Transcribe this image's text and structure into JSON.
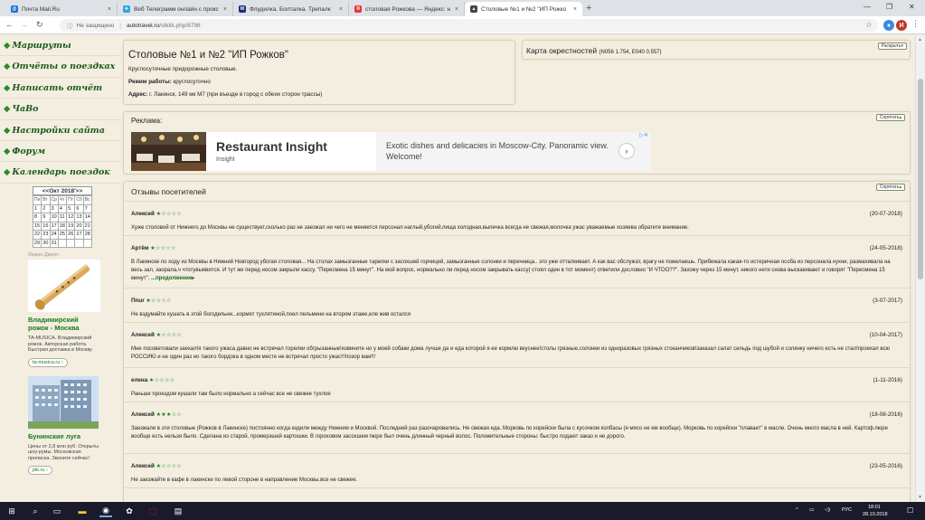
{
  "browser": {
    "tabs": [
      {
        "title": "Почта Mail.Ru",
        "color": "#1e6fd9",
        "glyph": "@"
      },
      {
        "title": "Веб Телеграмм онлайн с прокс",
        "color": "#2ca5e0",
        "glyph": "✈"
      },
      {
        "title": "Флудилка. Болталка. Трепалк",
        "color": "#1c2f7a",
        "glyph": "M"
      },
      {
        "title": "столовая Рожкова — Яндекс: н",
        "color": "#e33",
        "glyph": "Я"
      },
      {
        "title": "Столовые №1 и №2 \"ИП Рожко",
        "color": "#444",
        "glyph": "▲"
      }
    ],
    "new_tab": "+",
    "insecure_label": "Не защищено",
    "url_domain": "autotravel.ru",
    "url_path": "/otklik.php/8798",
    "profile_letter": "И"
  },
  "menu": [
    "Маршруты",
    "Отчёты о поездках",
    "Написать отчёт",
    "ЧаВо",
    "Настройки сайта",
    "Форум",
    "Календарь поездок"
  ],
  "calendar": {
    "header": "<<Окт 2018'>>",
    "days": [
      "Пн",
      "Вт",
      "Ср",
      "Чт",
      "Пт",
      "Сб",
      "Вс"
    ],
    "cells": [
      "1",
      "2",
      "3",
      "4",
      "5",
      "6",
      "7",
      "8",
      "9",
      "10",
      "11",
      "12",
      "13",
      "14",
      "15",
      "16",
      "17",
      "18",
      "19",
      "20",
      "21",
      "22",
      "23",
      "24",
      "25",
      "26",
      "27",
      "28",
      "29",
      "30",
      "31"
    ]
  },
  "side_ads": [
    {
      "label": "Яндекс.Директ",
      "title": "Владимирский рожок - Москва",
      "text": "TA-MUSICA. Владимирский рожок. Авторская работа. Быстрая доставка в Москву",
      "link": "ta-musica.ru ›"
    },
    {
      "title": "Бунинские луга",
      "text": "Цены от 2,8 млн руб. Открыты шоу-румы. Московская прописка. Звоните сейчас!",
      "link": "pik.ru ›"
    }
  ],
  "place": {
    "title": "Столовые №1 и №2 \"ИП Рожков\"",
    "desc": "Круглосуточные придорожные столовые.",
    "hours_label": "Режим работы:",
    "hours_value": "круглосуточно",
    "address_label": "Адрес:",
    "address_value": "г. Лакинск, 149 км М7 (при въезде в город с обеих сторон трассы)"
  },
  "map_box": {
    "title": "Карта окрестностей",
    "coords": "(N056 1.754, E040 0.557)",
    "expand_label": "Раскрыть"
  },
  "ads_box": {
    "title": "Реклама:",
    "hide_label": "Спрятать",
    "banner_title": "Restaurant Insight",
    "banner_sub": "Insight",
    "banner_desc": "Exotic dishes and delicacies in Moscow-City. Panoramic view. Welcome!"
  },
  "reviews_box": {
    "title": "Отзывы посетителей",
    "hide_label": "Спрятать",
    "more_label": "...продолжение▸",
    "items": [
      {
        "name": "Алексей",
        "stars": "★☆☆☆☆",
        "date": "(20-07-2018)",
        "text": "Хуже столовой от Нижнего до Москвы не существует,сколько раз не заезжал ни чего не меняется персонал наглый,убогий,пища холодная,выпечка всегда не свежая,молочка ужас уважаемые хозяева обратите внимание."
      },
      {
        "name": "Артём",
        "stars": "★☆☆☆☆",
        "date": "(24-05-2018)",
        "text": "В Лакинске по ходу из Москвы в Нижний Новгород убогая столовая... На столах замызганные тарелки с засохшей горчицей, замызганные солонки и перечница.. это уже отталкивает. А как вас обслужат, врагу не пожелаешь. Прибежала какая-то истеричная особа из персонала кухни, размахивала на весь зал, заорала,ч чтотувыявится. И тут же перед носом закрыли кассу. \"Пересмена 15 минут\". На мой вопрос, нормально ли перед носом закрывать кассу( стоял один в тот момент) ответили дословно \"И ЧТОО??\". Захожу через 15 минут, никого нети снова выскакивают и говорят \"Пересмена 15 минут\". "
      },
      {
        "name": "Пnur",
        "stars": "★☆☆☆☆",
        "date": "(3-07-2017)",
        "text": "Не вздумайте кушать в этой богодельни...кормят тухлятиной,поел пельмени на втором этаже,еле жив остался"
      },
      {
        "name": "Алексей",
        "stars": "★☆☆☆☆",
        "date": "(10-04-2017)",
        "text": "Мне посоветовали заехал!я такого ужаса давно не встречал торелки обгрызанные!извините но у моей собаки дома лучше да и еда которой я ее кормлю вкуснее!столы грязные,солонки из одноразовых грязных стоканчиков!заказал салат сельдь под шубой и солянку ничего есть не стал!проехал всю РОССИЮ и не один раз но такого бордока в одном месте не встречал просто ужас!!!позор вам!!!"
      },
      {
        "name": "елена",
        "stars": "★☆☆☆☆",
        "date": "(1-11-2016)",
        "text": "Раньше проездом кушали там было нормально а сейчас все не свежее тухлое"
      },
      {
        "name": "Алексей",
        "stars": "★★★☆☆",
        "date": "(18-08-2016)",
        "text": "Заезжали в эти столовые (Рожков в Лакинске) постоянно когда ездили между Нижним и Москвой. Последний раз разочаровались. Не свежая еда. Морковь по корейски была с кусочком колбасы (я мясо не ем вообще). Морковь по корейски \"плавает\" в масле. Очень много масла в ней. Картоф.пюре вообще есть нельзя было. Сделана из старой, промерзшей картошки. В гороховом засохшем пюре был очень длинный черный волос. Положительные стороны: быстро подают заказ и не дорого."
      },
      {
        "name": "Алексей",
        "stars": "★☆☆☆☆",
        "date": "(23-05-2016)",
        "text": "Не заезжайте в кафе в лакинске по левой стороне в направление Москвы.все не свежее."
      }
    ]
  },
  "taskbar": {
    "time": "18:01",
    "date": "28.10.2018",
    "lang": "РУС"
  }
}
